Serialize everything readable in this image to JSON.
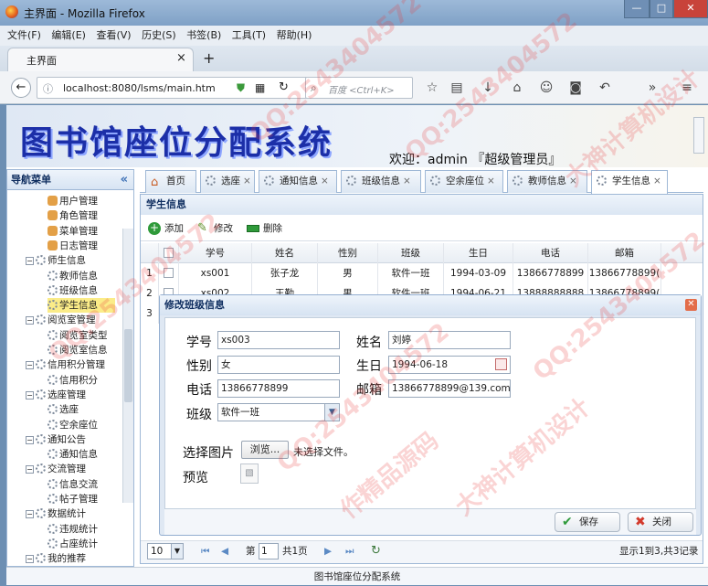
{
  "browser": {
    "window_title": "主界面 - Mozilla Firefox",
    "menu": [
      "文件(F)",
      "编辑(E)",
      "查看(V)",
      "历史(S)",
      "书签(B)",
      "工具(T)",
      "帮助(H)"
    ],
    "tab_title": "主界面",
    "tab_close": "×",
    "new_tab": "+",
    "url": "localhost:8080/lsms/main.htm",
    "search_placeholder": "百度 <Ctrl+K>"
  },
  "app": {
    "logo": "图书馆座位分配系统",
    "welcome": "欢迎：admin 『超级管理员』",
    "footer": "图书馆座位分配系统"
  },
  "sidebar": {
    "title": "导航菜单",
    "collapse": "«",
    "items": [
      {
        "label": "用户管理",
        "level": 2,
        "icon": "user-icon"
      },
      {
        "label": "角色管理",
        "level": 2,
        "icon": "role-icon"
      },
      {
        "label": "菜单管理",
        "level": 2,
        "icon": "menu-icon"
      },
      {
        "label": "日志管理",
        "level": 2,
        "icon": "log-icon"
      },
      {
        "label": "师生信息",
        "level": 1,
        "icon": "gear-icon"
      },
      {
        "label": "教师信息",
        "level": 2,
        "icon": "gear-icon"
      },
      {
        "label": "班级信息",
        "level": 2,
        "icon": "gear-icon"
      },
      {
        "label": "学生信息",
        "level": 2,
        "icon": "gear-icon",
        "selected": true
      },
      {
        "label": "阅览室管理",
        "level": 1,
        "icon": "gear-icon"
      },
      {
        "label": "阅览室类型",
        "level": 2,
        "icon": "gear-icon"
      },
      {
        "label": "阅览室信息",
        "level": 2,
        "icon": "gear-icon"
      },
      {
        "label": "信用积分管理",
        "level": 1,
        "icon": "gear-icon"
      },
      {
        "label": "信用积分",
        "level": 2,
        "icon": "gear-icon"
      },
      {
        "label": "选座管理",
        "level": 1,
        "icon": "gear-icon"
      },
      {
        "label": "选座",
        "level": 2,
        "icon": "gear-icon"
      },
      {
        "label": "空余座位",
        "level": 2,
        "icon": "gear-icon"
      },
      {
        "label": "通知公告",
        "level": 1,
        "icon": "gear-icon"
      },
      {
        "label": "通知信息",
        "level": 2,
        "icon": "gear-icon"
      },
      {
        "label": "交流管理",
        "level": 1,
        "icon": "gear-icon"
      },
      {
        "label": "信息交流",
        "level": 2,
        "icon": "gear-icon"
      },
      {
        "label": "帖子管理",
        "level": 2,
        "icon": "gear-icon"
      },
      {
        "label": "数据统计",
        "level": 1,
        "icon": "gear-icon"
      },
      {
        "label": "违规统计",
        "level": 2,
        "icon": "gear-icon"
      },
      {
        "label": "占座统计",
        "level": 2,
        "icon": "gear-icon"
      },
      {
        "label": "我的推荐",
        "level": 1,
        "icon": "gear-icon"
      }
    ]
  },
  "tabs": [
    {
      "label": "首页",
      "closable": false
    },
    {
      "label": "选座",
      "closable": true
    },
    {
      "label": "通知信息",
      "closable": true
    },
    {
      "label": "班级信息",
      "closable": true
    },
    {
      "label": "空余座位",
      "closable": true
    },
    {
      "label": "教师信息",
      "closable": true
    },
    {
      "label": "学生信息",
      "closable": true,
      "active": true
    }
  ],
  "panel": {
    "title": "学生信息",
    "toolbar": {
      "add": "添加",
      "edit": "修改",
      "delete": "删除"
    }
  },
  "grid": {
    "headers": [
      "学号",
      "姓名",
      "性别",
      "班级",
      "生日",
      "电话",
      "邮箱"
    ],
    "rows": [
      {
        "num": "1",
        "cells": [
          "xs001",
          "张子龙",
          "男",
          "软件一班",
          "1994-03-09",
          "13866778899",
          "13866778899("
        ]
      },
      {
        "num": "2",
        "cells": [
          "xs002",
          "王勤",
          "男",
          "软件一班",
          "1994-06-21",
          "13888888888",
          "13866778899("
        ]
      },
      {
        "num": "3",
        "cells": [
          "",
          "",
          "",
          "",
          "",
          "",
          ""
        ]
      }
    ]
  },
  "dialog": {
    "title": "修改班级信息",
    "close": "✕",
    "fields": {
      "xh_label": "学号",
      "xh_value": "xs003",
      "xm_label": "姓名",
      "xm_value": "刘婷",
      "xb_label": "性别",
      "xb_value": "女",
      "sr_label": "生日",
      "sr_value": "1994-06-18",
      "dh_label": "电话",
      "dh_value": "13866778899",
      "yx_label": "邮箱",
      "yx_value": "13866778899@139.com",
      "bj_label": "班级",
      "bj_value": "软件一班"
    },
    "pic_label": "选择图片",
    "browse": "浏览...",
    "no_file": "未选择文件。",
    "preview_label": "预览",
    "save": "保存",
    "cancel": "关闭"
  },
  "pager": {
    "page_size": "10",
    "page_prefix": "第",
    "page_value": "1",
    "page_suffix": "共1页",
    "summary": "显示1到3,共3记录"
  },
  "watermarks": [
    "QQ:2543404572",
    "大神计算机设计",
    "作精品源码"
  ],
  "colors": {
    "accent": "#1c2fa8",
    "selected": "#fbec88",
    "border": "#9fb8d6"
  }
}
